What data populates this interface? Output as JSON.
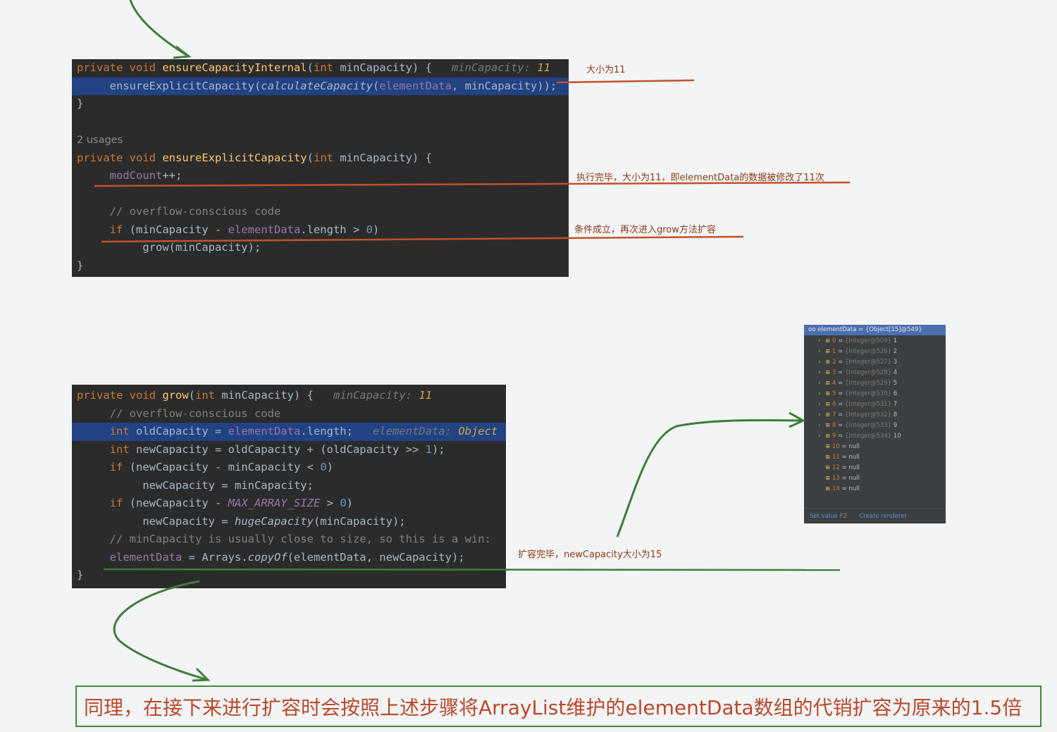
{
  "block1": {
    "line1": {
      "kw": "private void ",
      "fn": "ensureCapacityInternal",
      "p1": "(",
      "kwint": "int",
      "p2": " minCapacity) {",
      "hint_label": "minCapacity: ",
      "hint_value": "11"
    },
    "line2": {
      "indent": "     ",
      "call1": "ensureExplicitCapacity(",
      "call2": "calculateCapacity",
      "p": "(",
      "fld": "elementData",
      "rest": ", minCapacity));"
    },
    "line3": "}",
    "usages": "2 usages",
    "line5": {
      "kw": "private void ",
      "fn": "ensureExplicitCapacity",
      "p1": "(",
      "kwint": "int",
      "p2": " minCapacity) {"
    },
    "line6": {
      "indent": "     ",
      "fld": "modCount",
      "rest": "++;"
    },
    "line8": {
      "indent": "     ",
      "cmt": "// overflow-conscious code"
    },
    "line9": {
      "indent": "     ",
      "kw": "if",
      "p1": " (minCapacity - ",
      "fld": "elementData",
      "p2": ".length > ",
      "num": "0",
      "p3": ")"
    },
    "line10": {
      "indent": "          ",
      "text": "grow(minCapacity);"
    },
    "line11": "}"
  },
  "block2": {
    "line1": {
      "kw": "private void ",
      "fn": "grow",
      "p1": "(",
      "kwint": "int",
      "p2": " minCapacity) {",
      "hint_label": "minCapacity: ",
      "hint_value": "11"
    },
    "line2": {
      "indent": "     ",
      "cmt": "// overflow-conscious code"
    },
    "line3": {
      "indent": "     ",
      "kw": "int",
      "p1": " oldCapacity = ",
      "fld": "elementData",
      "p2": ".length;",
      "hint_label": "elementData: ",
      "hint_value": "Object"
    },
    "line4": {
      "indent": "     ",
      "kw": "int",
      "p1": " newCapacity = oldCapacity + (oldCapacity >> ",
      "num": "1",
      "p2": ");"
    },
    "line5": {
      "indent": "     ",
      "kw": "if",
      "p1": " (newCapacity - minCapacity < ",
      "num": "0",
      "p2": ")"
    },
    "line6": {
      "indent": "          ",
      "text": "newCapacity = minCapacity;"
    },
    "line7": {
      "indent": "     ",
      "kw": "if",
      "p1": " (newCapacity - ",
      "ifld": "MAX_ARRAY_SIZE",
      "p2": " > ",
      "num": "0",
      "p3": ")"
    },
    "line8": {
      "indent": "          ",
      "p1": "newCapacity = ",
      "it": "hugeCapacity",
      "p2": "(minCapacity);"
    },
    "line9": {
      "indent": "     ",
      "cmt": "// minCapacity is usually close to size, so this is a win:"
    },
    "line10": {
      "indent": "     ",
      "fld": "elementData",
      "p1": " = Arrays.",
      "it": "copyOf",
      "p2": "(elementData, newCapacity);"
    },
    "line11": "}"
  },
  "annotations": {
    "a1": "大小为11",
    "a2": "执行完毕，大小为11，即elementData的数据被修改了11次",
    "a3": "条件成立，再次进入grow方法扩容",
    "a4": "扩容完毕，newCapacity大小为15"
  },
  "debugger": {
    "header": "oo elementData = {Object[15]@549}",
    "rows": [
      {
        "idx": "0",
        "ref": "{Integer@509}",
        "val": "1",
        "expandable": true
      },
      {
        "idx": "1",
        "ref": "{Integer@526}",
        "val": "2",
        "expandable": true
      },
      {
        "idx": "2",
        "ref": "{Integer@527}",
        "val": "3",
        "expandable": true
      },
      {
        "idx": "3",
        "ref": "{Integer@528}",
        "val": "4",
        "expandable": true
      },
      {
        "idx": "4",
        "ref": "{Integer@529}",
        "val": "5",
        "expandable": true
      },
      {
        "idx": "5",
        "ref": "{Integer@530}",
        "val": "6",
        "expandable": true
      },
      {
        "idx": "6",
        "ref": "{Integer@531}",
        "val": "7",
        "expandable": true
      },
      {
        "idx": "7",
        "ref": "{Integer@532}",
        "val": "8",
        "expandable": true
      },
      {
        "idx": "8",
        "ref": "{Integer@533}",
        "val": "9",
        "expandable": true
      },
      {
        "idx": "9",
        "ref": "{Integer@534}",
        "val": "10",
        "expandable": true
      },
      {
        "idx": "10",
        "ref": "",
        "val": "null",
        "expandable": false
      },
      {
        "idx": "11",
        "ref": "",
        "val": "null",
        "expandable": false
      },
      {
        "idx": "12",
        "ref": "",
        "val": "null",
        "expandable": false
      },
      {
        "idx": "13",
        "ref": "",
        "val": "null",
        "expandable": false
      },
      {
        "idx": "14",
        "ref": "",
        "val": "null",
        "expandable": false
      }
    ],
    "set_value": "Set value",
    "set_value_key": "F2",
    "create_renderer": "Create renderer"
  },
  "note": "同理，在接下来进行扩容时会按照上述步骤将ArrayList维护的elementData数组的代销扩容为原来的1.5倍",
  "colors": {
    "annotation_line": "#c0522a",
    "arrow": "#3f7d3a",
    "note_text": "#b8492b",
    "editor_bg": "#2b2b2b",
    "selection": "#214283"
  }
}
